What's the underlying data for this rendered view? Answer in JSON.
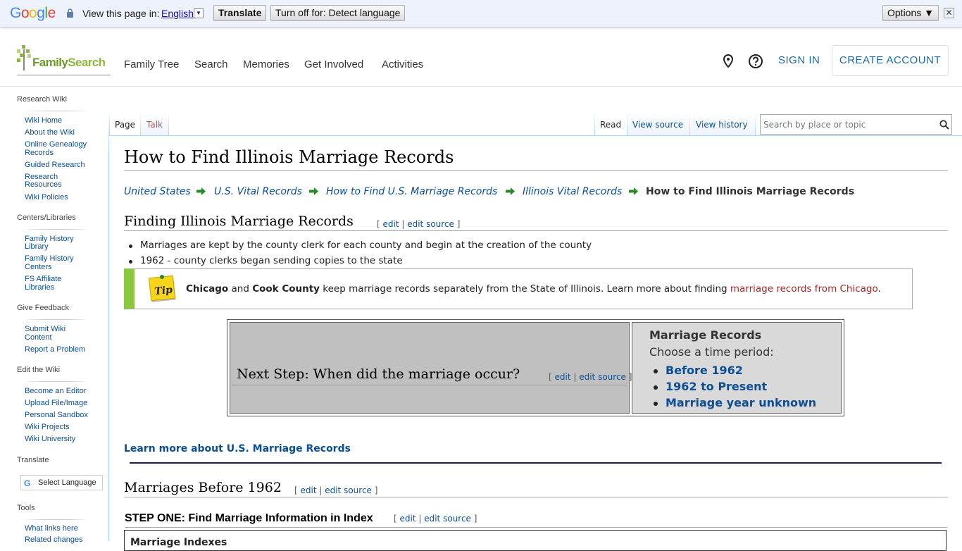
{
  "translate_bar": {
    "logo": "Google",
    "view_label": "View this page in:",
    "language": "English",
    "translate_btn": "Translate",
    "turn_off_btn": "Turn off for: Detect language",
    "options_btn": "Options ▼",
    "close": "✕"
  },
  "header": {
    "logo_text_a": "Family",
    "logo_text_b": "Search",
    "nav": [
      "Family Tree",
      "Search",
      "Memories",
      "Get Involved",
      "Activities"
    ],
    "sign_in": "SIGN IN",
    "create_account": "CREATE ACCOUNT"
  },
  "sidebar": {
    "sections": [
      {
        "title": "Research Wiki",
        "items": [
          "Wiki Home",
          "About the Wiki",
          "Online Genealogy",
          "Records",
          "Guided Research",
          "Research",
          "Resources",
          "Wiki Policies"
        ]
      },
      {
        "title": "Centers/Libraries",
        "items": [
          "Family History",
          "Library",
          "Family History",
          "Centers",
          "FS Affiliate",
          "Libraries"
        ]
      },
      {
        "title": "Give Feedback",
        "items": [
          "Submit Wiki",
          "Content",
          "Report a Problem"
        ]
      },
      {
        "title": "Edit the Wiki",
        "items": [
          "Become an Editor",
          "Upload File/Image",
          "Personal Sandbox",
          "Wiki Projects",
          "Wiki University"
        ]
      },
      {
        "title": "Translate",
        "items": []
      },
      {
        "title": "Tools",
        "items": [
          "What links here",
          "Related changes"
        ]
      }
    ],
    "select_language": "Select Language",
    "select_language_g": "G"
  },
  "tabs": {
    "page": "Page",
    "talk": "Talk",
    "read": "Read",
    "view_source": "View source",
    "view_history": "View history"
  },
  "search": {
    "placeholder": "Search by place or topic"
  },
  "article": {
    "title": "How to Find Illinois Marriage Records",
    "breadcrumb": [
      "United States",
      "U.S. Vital Records",
      "How to Find U.S. Marriage Records",
      "Illinois Vital Records"
    ],
    "breadcrumb_current": "How to Find Illinois Marriage Records",
    "section1": {
      "heading": "Finding Illinois Marriage Records",
      "bullets": [
        "Marriages are kept by the county clerk for each county and begin at the creation of the county",
        "1962 - county clerks began sending copies to the state"
      ]
    },
    "edit": {
      "open": "[ ",
      "edit": "edit",
      "sep": " | ",
      "edit_source": "edit source",
      "close": " ]"
    },
    "tip": {
      "b1": "Chicago",
      "t1": " and ",
      "b2": "Cook County",
      "t2": " keep marriage records separately from the State of Illinois. Learn more about finding ",
      "link": "marriage records from Chicago",
      "t3": ".",
      "img_label": "Tip"
    },
    "next_step": {
      "question": "Next Step: When did the marriage occur?",
      "title": "Marriage Records",
      "subtitle": "Choose a time period:",
      "options": [
        "Before 1962",
        "1962 to Present",
        "Marriage year unknown"
      ]
    },
    "learn_more": "Learn more about U.S. Marriage Records",
    "section2": {
      "heading": "Marriages Before 1962"
    },
    "step_one": "STEP ONE: Find Marriage Information in Index",
    "index_box_title": "Marriage Indexes"
  },
  "colors": {
    "accent": "#0b4e94",
    "tip_green": "#8dc63f",
    "fs_green": "#8cb83f",
    "link_red": "#a82727"
  }
}
